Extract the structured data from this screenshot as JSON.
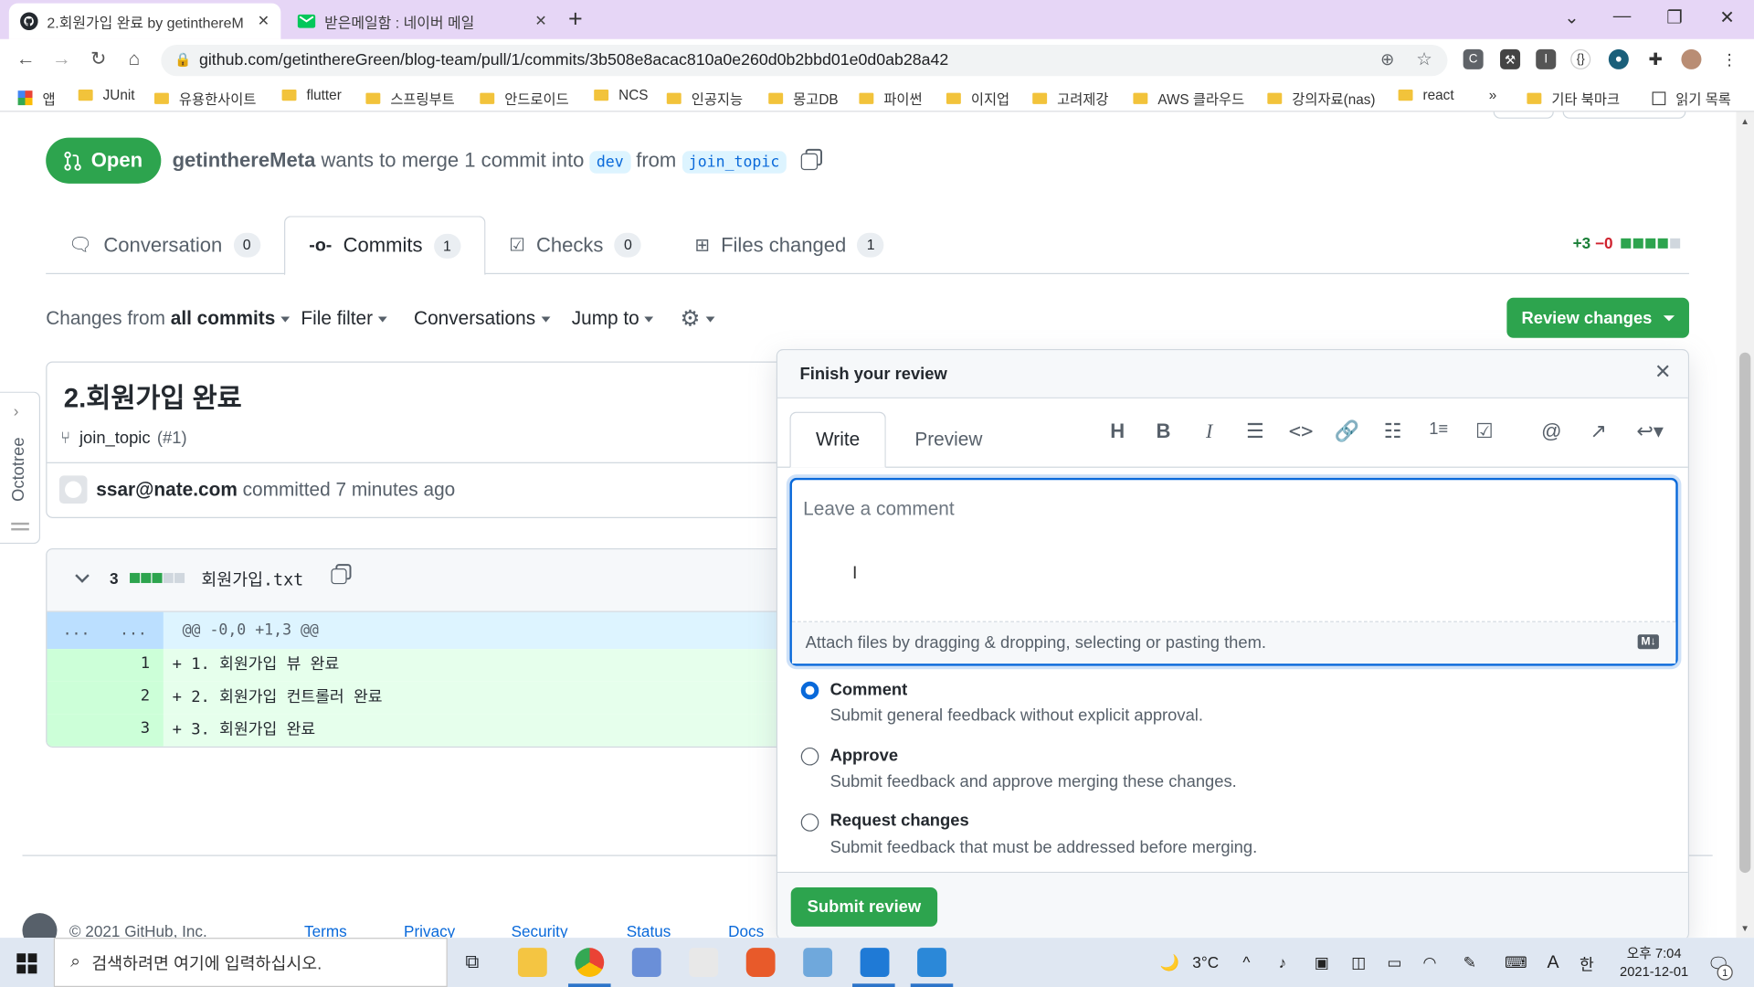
{
  "browser": {
    "tabs": [
      {
        "title": "2.회원가입 완료 by getinthereM",
        "active": true
      },
      {
        "title": "받은메일함 : 네이버 메일",
        "active": false
      }
    ],
    "new_tab": "+",
    "url": "github.com/getinthereGreen/blog-team/pull/1/commits/3b508e8acac810a0e260d0b2bbd01e0d0ab28a42",
    "bookmarks": [
      "앱",
      "JUnit",
      "유용한사이트",
      "flutter",
      "스프링부트",
      "안드로이드",
      "NCS",
      "인공지능",
      "몽고DB",
      "파이썬",
      "이지업",
      "고려제강",
      "AWS 클라우드",
      "강의자료(nas)",
      "react",
      "»",
      "기타 북마크",
      "읽기 목록"
    ]
  },
  "pr": {
    "state": "Open",
    "author": "getinthereMeta",
    "merge_text": "wants to merge 1 commit into",
    "base": "dev",
    "from": "from",
    "head": "join_topic",
    "tabs": [
      {
        "label": "Conversation",
        "count": "0"
      },
      {
        "label": "Commits",
        "count": "1"
      },
      {
        "label": "Checks",
        "count": "0"
      },
      {
        "label": "Files changed",
        "count": "1"
      }
    ],
    "diffstat": {
      "add": "+3",
      "del": "−0"
    },
    "filters": {
      "changes_prefix": "Changes from",
      "changes_value": "all commits",
      "file_filter": "File filter",
      "conversations": "Conversations",
      "jump_to": "Jump to"
    },
    "review_button": "Review changes"
  },
  "commit": {
    "title": "2.회원가입 완료",
    "branch": "join_topic",
    "pr_ref": "(#1)",
    "author": "ssar@nate.com",
    "committed": "committed",
    "time": "7 minutes ago"
  },
  "file": {
    "additions": "3",
    "name": "회원가입.txt",
    "hunk_left": "...",
    "hunk_right": "...",
    "hunk": "@@ -0,0 +1,3 @@",
    "lines": [
      {
        "num": "1",
        "code": "+ 1. 회원가입 뷰 완료"
      },
      {
        "num": "2",
        "code": "+ 2. 회원가입 컨트롤러 완료"
      },
      {
        "num": "3",
        "code": "+ 3. 회원가입 완료"
      }
    ]
  },
  "review": {
    "title": "Finish your review",
    "write": "Write",
    "preview": "Preview",
    "placeholder": "Leave a comment",
    "attach": "Attach files by dragging & dropping, selecting or pasting them.",
    "md": "M↓",
    "options": [
      {
        "title": "Comment",
        "desc": "Submit general feedback without explicit approval.",
        "checked": true
      },
      {
        "title": "Approve",
        "desc": "Submit feedback and approve merging these changes.",
        "checked": false
      },
      {
        "title": "Request changes",
        "desc": "Submit feedback that must be addressed before merging.",
        "checked": false
      }
    ],
    "submit": "Submit review"
  },
  "footer": {
    "copyright": "© 2021 GitHub, Inc.",
    "links": [
      "Terms",
      "Privacy",
      "Security",
      "Status",
      "Docs"
    ]
  },
  "octotree": {
    "label": "Octotree"
  },
  "taskbar": {
    "search_placeholder": "검색하려면 여기에 입력하십시오.",
    "weather": "3°C",
    "ime": "한",
    "lang": "A",
    "time": "오후 7:04",
    "date": "2021-12-01",
    "notif": "1"
  }
}
